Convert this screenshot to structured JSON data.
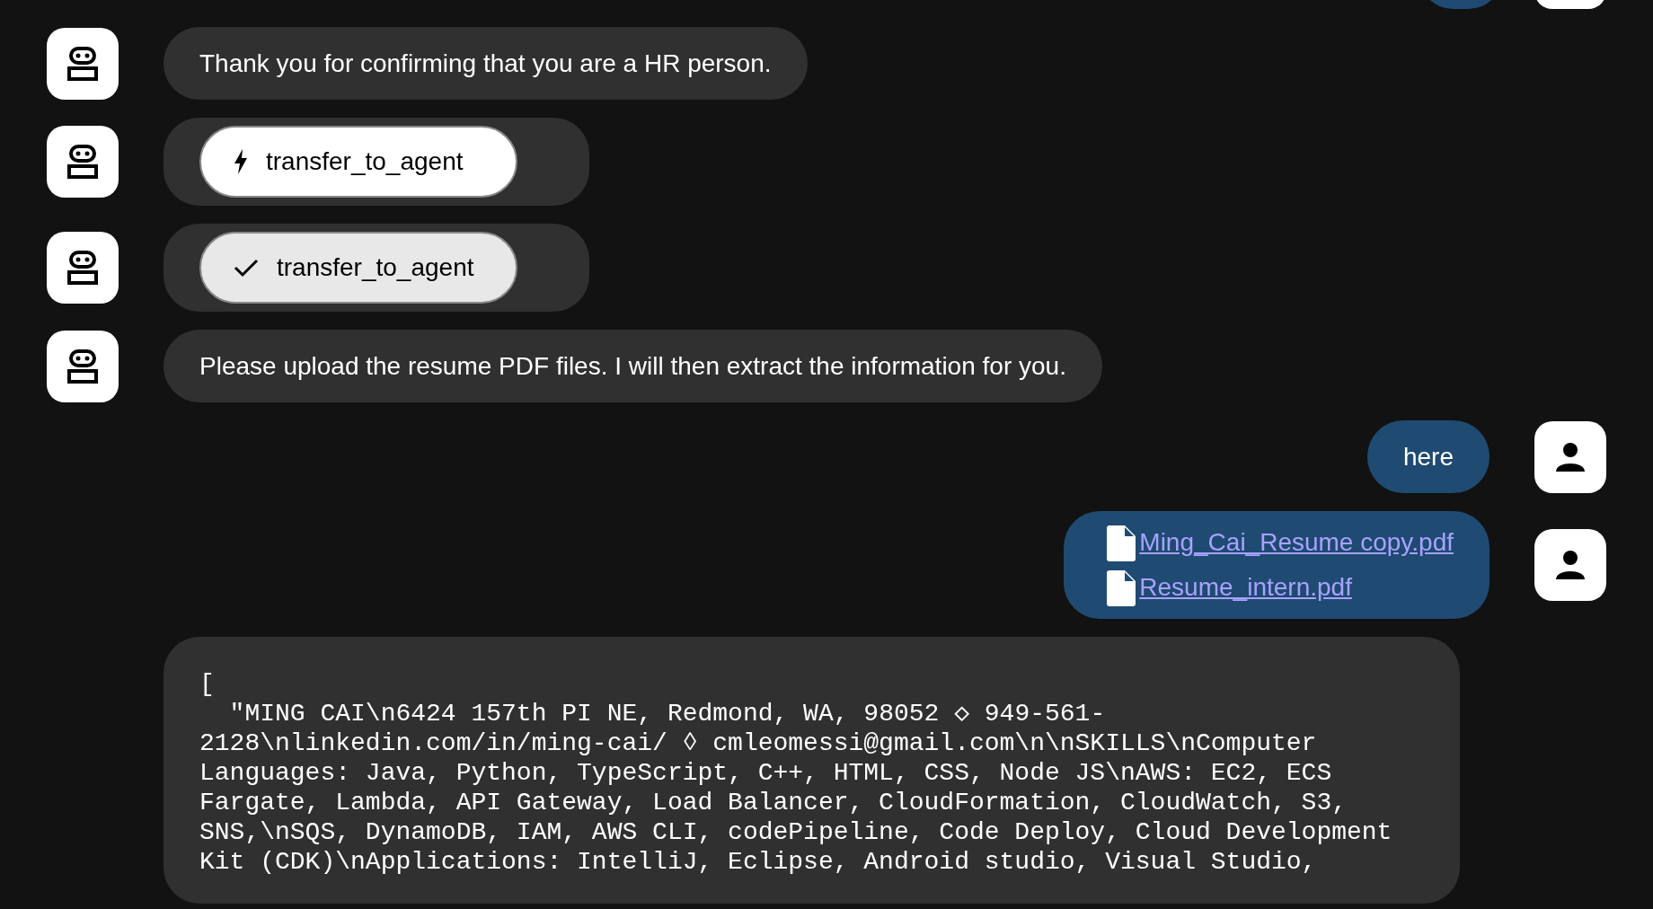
{
  "messages": [
    {
      "from_user": true,
      "kind": "clipped"
    },
    {
      "from_user": false,
      "kind": "text",
      "text": "Thank you for confirming that you are a HR person."
    },
    {
      "from_user": false,
      "kind": "tool_call",
      "name": "transfer_to_agent",
      "done": false
    },
    {
      "from_user": false,
      "kind": "tool_call",
      "name": "transfer_to_agent",
      "done": true
    },
    {
      "from_user": false,
      "kind": "text",
      "text": "Please upload the resume PDF files. I will then extract the information for you."
    },
    {
      "from_user": true,
      "kind": "text",
      "text": "here"
    },
    {
      "from_user": true,
      "kind": "files",
      "files": [
        "Ming_Cai_Resume copy.pdf",
        "Resume_intern.pdf"
      ]
    },
    {
      "from_user": false,
      "kind": "code",
      "text": "[\n  \"MING CAI\\n6424 157th PI NE, Redmond, WA, 98052 ◇ 949-561-2128\\nlinkedin.com/in/ming-cai/ ◊ cmleomessi@gmail.com\\n\\nSKILLS\\nComputer Languages: Java, Python, TypeScript, C++, HTML, CSS, Node JS\\nAWS: EC2, ECS Fargate, Lambda, API Gateway, Load Balancer, CloudFormation, CloudWatch, S3, SNS,\\nSQS, DynamoDB, IAM, AWS CLI, codePipeline, Code Deploy, Cloud Development Kit (CDK)\\nApplications: IntelliJ, Eclipse, Android studio, Visual Studio,"
    }
  ]
}
